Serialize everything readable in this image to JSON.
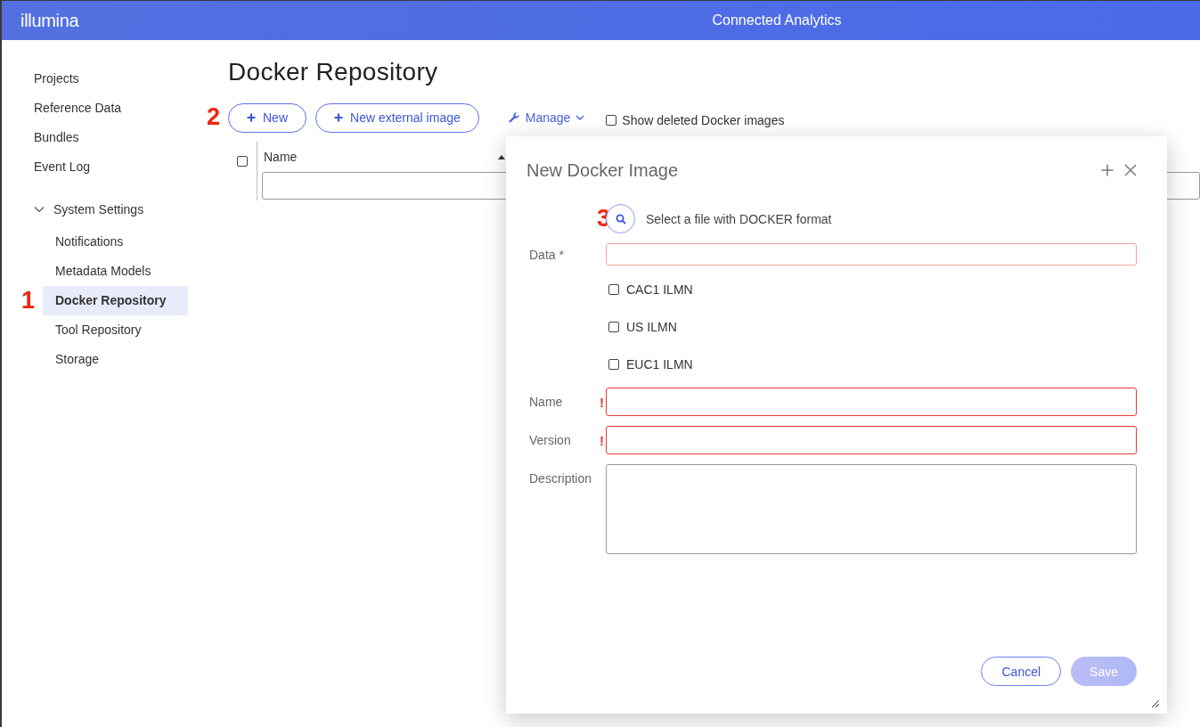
{
  "header": {
    "logo": "illumina",
    "title": "Connected Analytics"
  },
  "sidebar": {
    "items": [
      {
        "label": "Projects",
        "selected": false
      },
      {
        "label": "Reference Data",
        "selected": false
      },
      {
        "label": "Bundles",
        "selected": false
      },
      {
        "label": "Event Log",
        "selected": false
      },
      {
        "label": "System Settings",
        "expanded": true,
        "children": [
          {
            "label": "Notifications",
            "selected": false
          },
          {
            "label": "Metadata Models",
            "selected": false
          },
          {
            "label": "Docker Repository",
            "selected": true,
            "callout": "1"
          },
          {
            "label": "Tool Repository",
            "selected": false
          },
          {
            "label": "Storage",
            "selected": false
          }
        ]
      }
    ]
  },
  "page": {
    "title": "Docker Repository",
    "callout": "2",
    "toolbar": [
      {
        "kind": "button",
        "label": "New"
      },
      {
        "kind": "button",
        "label": "New external image"
      },
      {
        "kind": "menu",
        "label": "Manage"
      },
      {
        "kind": "checkbox",
        "label": "Show deleted Docker images",
        "checked": false
      }
    ],
    "table": {
      "select_all_checked": false,
      "columns": [
        {
          "label": "Name",
          "sorted": true
        }
      ]
    }
  },
  "dialog": {
    "title": "New Docker Image",
    "file_picker": {
      "callout": "3",
      "label": "Select a file with DOCKER format"
    },
    "fields": [
      {
        "kind": "input",
        "label": "Data *",
        "required": true,
        "invalid": false
      },
      {
        "kind": "checkbox",
        "label": "CAC1 ILMN",
        "checked": false
      },
      {
        "kind": "checkbox",
        "label": "US ILMN",
        "checked": false
      },
      {
        "kind": "checkbox",
        "label": "EUC1 ILMN",
        "checked": false
      },
      {
        "kind": "input",
        "label": "Name",
        "invalid": true,
        "error_mark": "!"
      },
      {
        "kind": "input",
        "label": "Version",
        "invalid": true,
        "error_mark": "!"
      },
      {
        "kind": "textarea",
        "label": "Description",
        "invalid": false
      }
    ],
    "buttons": [
      {
        "label": "Cancel",
        "disabled": false
      },
      {
        "label": "Save",
        "disabled": true
      }
    ]
  }
}
